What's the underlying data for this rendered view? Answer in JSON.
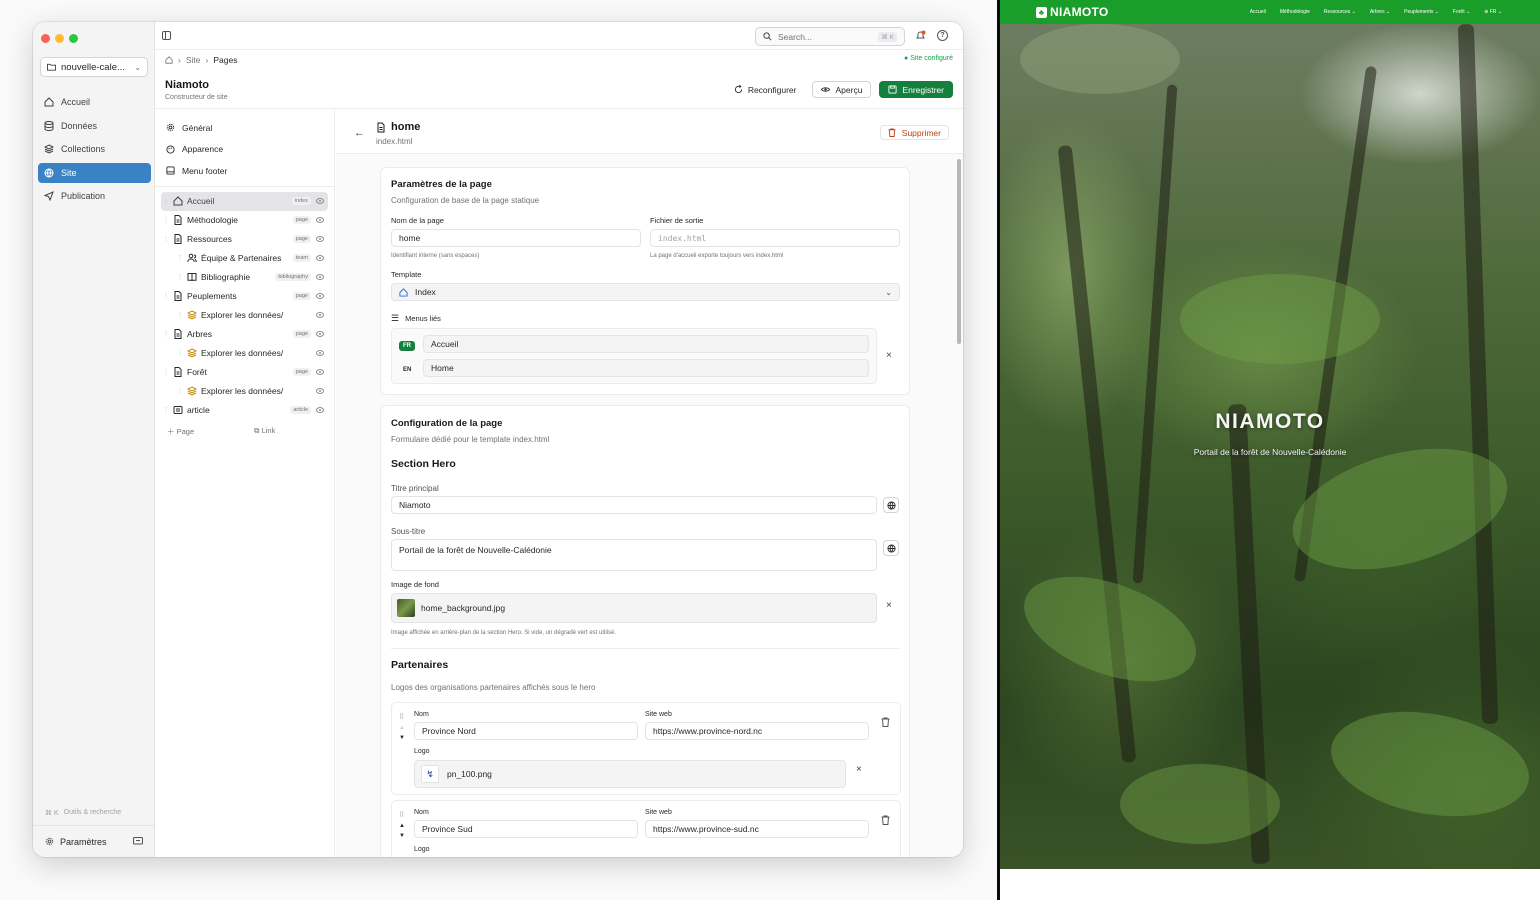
{
  "window": {
    "project": "nouvelle-cale...",
    "nav": [
      {
        "label": "Accueil",
        "icon": "home-icon"
      },
      {
        "label": "Données",
        "icon": "database-icon"
      },
      {
        "label": "Collections",
        "icon": "layers-icon"
      },
      {
        "label": "Site",
        "icon": "globe-icon",
        "active": true
      },
      {
        "label": "Publication",
        "icon": "send-icon"
      }
    ],
    "shortcut_keys": "⌘ K",
    "shortcut_label": "Outils & recherche",
    "settings_label": "Paramètres"
  },
  "topbar": {
    "search_placeholder": "Search...",
    "search_kbd": "⌘ K"
  },
  "breadcrumb": {
    "site": "Site",
    "pages": "Pages"
  },
  "status": "● Site configuré",
  "header": {
    "title": "Niamoto",
    "subtitle": "Constructeur de site",
    "reconfigure": "Reconfigurer",
    "preview": "Aperçu",
    "save": "Enregistrer"
  },
  "tree": {
    "top": [
      {
        "label": "Général"
      },
      {
        "label": "Apparence"
      },
      {
        "label": "Menu footer"
      }
    ],
    "pages": [
      {
        "label": "Accueil",
        "badge": "index",
        "selected": true
      },
      {
        "label": "Méthodologie",
        "badge": "page"
      },
      {
        "label": "Ressources",
        "badge": "page"
      },
      {
        "label": "Équipe & Partenaires",
        "badge": "team",
        "child": true
      },
      {
        "label": "Bibliographie",
        "badge": "bibliography",
        "child": true
      },
      {
        "label": "Peuplements",
        "badge": "page"
      },
      {
        "label": "Explorer les données/",
        "badge": "",
        "child": true
      },
      {
        "label": "Arbres",
        "badge": "page"
      },
      {
        "label": "Explorer les données/",
        "badge": "",
        "child": true
      },
      {
        "label": "Forêt",
        "badge": "page"
      },
      {
        "label": "Explorer les données/",
        "badge": "",
        "child": true
      },
      {
        "label": "article",
        "badge": "article"
      }
    ],
    "add_page": "Page",
    "add_link": "Link"
  },
  "editor": {
    "title": "home",
    "file": "index.html",
    "delete": "Supprimer",
    "params": {
      "title": "Paramètres de la page",
      "subtitle": "Configuration de base de la page statique",
      "name_label": "Nom de la page",
      "name_value": "home",
      "name_hint": "Identifiant interne (sans espaces)",
      "output_label": "Fichier de sortie",
      "output_value": "index.html",
      "output_hint": "La page d'accueil exporte toujours vers index.html",
      "template_label": "Template",
      "template_value": "Index",
      "menus_label": "Menus liés",
      "menu_fr": "FR",
      "menu_fr_value": "Accueil",
      "menu_en": "EN",
      "menu_en_value": "Home"
    },
    "config": {
      "title": "Configuration de la page",
      "subtitle": "Formulaire dédié pour le template index.html",
      "hero_section": "Section Hero",
      "main_title_label": "Titre principal",
      "main_title_value": "Niamoto",
      "subtitle_label": "Sous-titre",
      "subtitle_value": "Portail de la forêt de Nouvelle-Calédonie",
      "bg_label": "Image de fond",
      "bg_value": "home_background.jpg",
      "bg_hint": "Image affichée en arrière-plan de la section Hero. Si vide, un dégradé vert est utilisé.",
      "partners_title": "Partenaires",
      "partners_sub": "Logos des organisations partenaires affichés sous le hero",
      "partners": [
        {
          "name_label": "Nom",
          "name": "Province Nord",
          "web_label": "Site web",
          "web": "https://www.province-nord.nc",
          "logo_label": "Logo",
          "logo": "pn_100.png"
        },
        {
          "name_label": "Nom",
          "name": "Province Sud",
          "web_label": "Site web",
          "web": "https://www.province-sud.nc",
          "logo_label": "Logo"
        }
      ]
    }
  },
  "preview": {
    "brand": "NIAMOTO",
    "links": [
      "Accueil",
      "Méthodologie",
      "Ressources ⌄",
      "Arbres ⌄",
      "Peuplements ⌄",
      "Forêt ⌄",
      "⊕ FR ⌄"
    ],
    "hero_title": "NIAMOTO",
    "hero_subtitle": "Portail de la forêt de Nouvelle-Calédonie",
    "nav_color": "#1a9e2a"
  }
}
